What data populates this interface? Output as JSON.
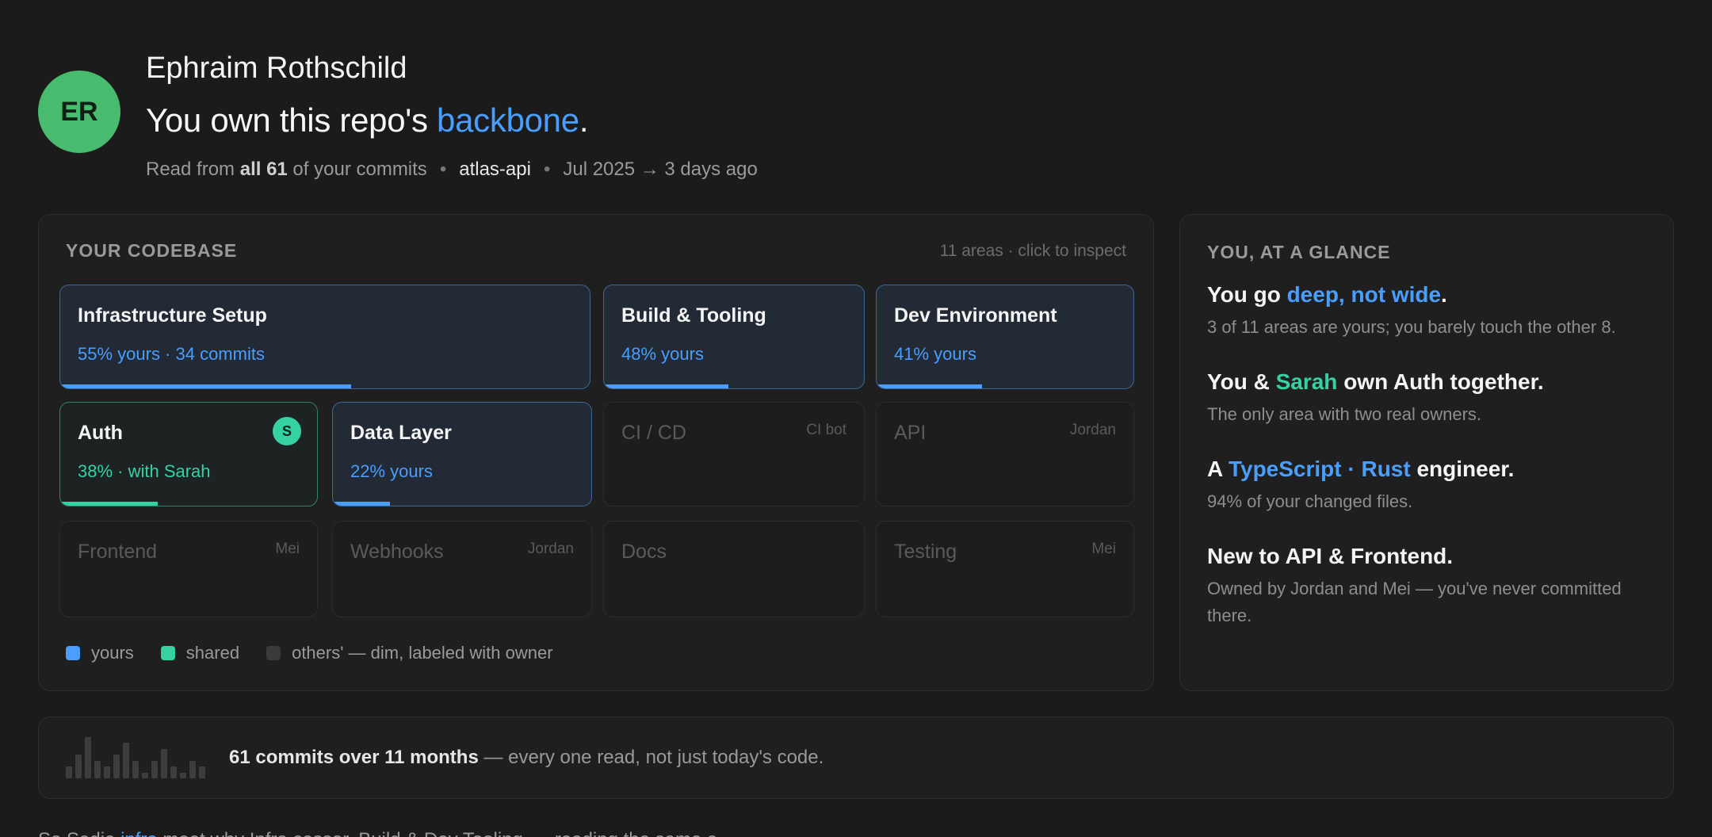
{
  "user": {
    "initials": "ER",
    "name": "Ephraim Rothschild",
    "headline_prefix": "You own this repo's ",
    "headline_accent": "backbone",
    "headline_suffix": "."
  },
  "meta": {
    "read_prefix": "Read from ",
    "read_bold": "all 61",
    "read_suffix": " of your commits",
    "repo": "atlas-api",
    "range": "Jul 2025 → 3 days ago"
  },
  "codebase": {
    "title": "YOUR CODEBASE",
    "hint": "11 areas · click to inspect",
    "tiles": [
      {
        "name": "Infrastructure Setup",
        "sub": "55% yours · 34 commits",
        "owner": "",
        "kind": "mine",
        "share": 0.55
      },
      {
        "name": "Build & Tooling",
        "sub": "48% yours",
        "owner": "",
        "kind": "mine",
        "share": 0.48
      },
      {
        "name": "Dev Environment",
        "sub": "41% yours",
        "owner": "",
        "kind": "mine",
        "share": 0.41
      },
      {
        "name": "Auth",
        "sub": "38% · with Sarah",
        "owner": "",
        "badge": "S",
        "kind": "shared",
        "share": 0.38
      },
      {
        "name": "Data Layer",
        "sub": "22% yours",
        "owner": "",
        "kind": "mine",
        "share": 0.22
      },
      {
        "name": "CI / CD",
        "sub": "",
        "owner": "CI bot",
        "kind": "dim"
      },
      {
        "name": "API",
        "sub": "",
        "owner": "Jordan",
        "kind": "dim"
      },
      {
        "name": "Frontend",
        "sub": "",
        "owner": "Mei",
        "kind": "dim"
      },
      {
        "name": "Webhooks",
        "sub": "",
        "owner": "Jordan",
        "kind": "dim"
      },
      {
        "name": "Docs",
        "sub": "",
        "owner": "",
        "kind": "dim"
      },
      {
        "name": "Testing",
        "sub": "",
        "owner": "Mei",
        "kind": "dim"
      }
    ],
    "legend": {
      "yours": "yours",
      "shared": "shared",
      "others": "others' — dim, labeled with owner",
      "colors": {
        "yours": "#4a9eff",
        "shared": "#36d1a2",
        "others": "#3a3a3a"
      }
    }
  },
  "glance": {
    "title": "YOU, AT A GLANCE",
    "items": [
      {
        "pre": "You go ",
        "accent": "deep, not wide",
        "post": ".",
        "color": "blue",
        "body": "3 of 11 areas are yours; you barely touch the other 8."
      },
      {
        "pre": "You & ",
        "accent": "Sarah",
        "post": " own Auth together.",
        "color": "green",
        "body": "The only area with two real owners."
      },
      {
        "pre": "A ",
        "accent": "TypeScript · Rust",
        "post": " engineer.",
        "color": "blue",
        "body": "94% of your changed files."
      },
      {
        "pre": "New to API & Frontend.",
        "accent": "",
        "post": "",
        "color": "blue",
        "body": "Owned by Jordan and Mei — you've never committed there."
      }
    ]
  },
  "timeline": {
    "bold": "61 commits over 11 months",
    "rest": " — every one read, not just today's code.",
    "monthly_commits": [
      2,
      4,
      7,
      3,
      2,
      4,
      6,
      3,
      1,
      3,
      5,
      2,
      1,
      3,
      2
    ]
  },
  "footer": {
    "pre": "So Sadie ",
    "accent": "infra",
    "post": " meet why Infra cessor, Build & Dev Tooling, ... reading the same a..."
  }
}
